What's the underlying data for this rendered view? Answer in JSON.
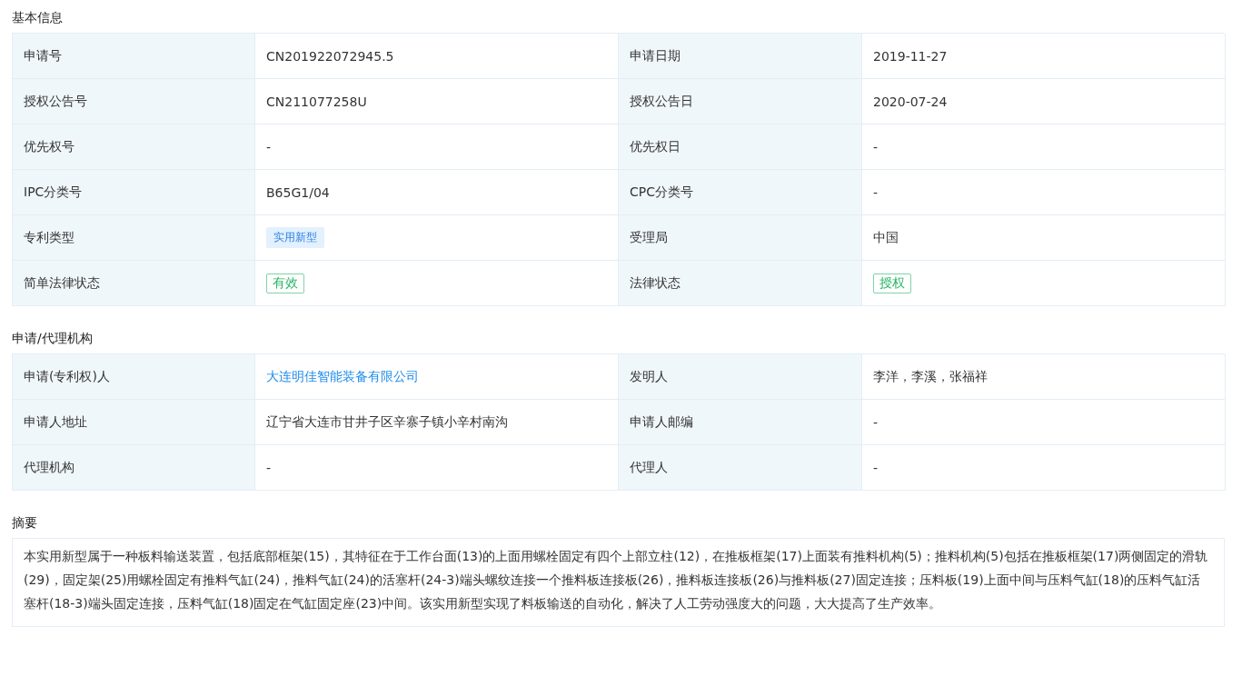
{
  "sections": [
    {
      "title": "基本信息",
      "rows": [
        [
          {
            "label": "申请号",
            "value": "CN201922072945.5",
            "kind": "text"
          },
          {
            "label": "申请日期",
            "value": "2019-11-27",
            "kind": "text"
          }
        ],
        [
          {
            "label": "授权公告号",
            "value": "CN211077258U",
            "kind": "text"
          },
          {
            "label": "授权公告日",
            "value": "2020-07-24",
            "kind": "text"
          }
        ],
        [
          {
            "label": "优先权号",
            "value": "-",
            "kind": "text"
          },
          {
            "label": "优先权日",
            "value": "-",
            "kind": "text"
          }
        ],
        [
          {
            "label": "IPC分类号",
            "value": "B65G1/04",
            "kind": "text"
          },
          {
            "label": "CPC分类号",
            "value": "-",
            "kind": "text"
          }
        ],
        [
          {
            "label": "专利类型",
            "value": "实用新型",
            "kind": "tag"
          },
          {
            "label": "受理局",
            "value": "中国",
            "kind": "text"
          }
        ],
        [
          {
            "label": "简单法律状态",
            "value": "有效",
            "kind": "status"
          },
          {
            "label": "法律状态",
            "value": "授权",
            "kind": "status"
          }
        ]
      ]
    },
    {
      "title": "申请/代理机构",
      "rows": [
        [
          {
            "label": "申请(专利权)人",
            "value": "大连明佳智能装备有限公司",
            "kind": "link"
          },
          {
            "label": "发明人",
            "value": "李洋，李溪，张福祥",
            "kind": "text"
          }
        ],
        [
          {
            "label": "申请人地址",
            "value": "辽宁省大连市甘井子区辛寨子镇小辛村南沟",
            "kind": "text"
          },
          {
            "label": "申请人邮编",
            "value": "-",
            "kind": "text"
          }
        ],
        [
          {
            "label": "代理机构",
            "value": "-",
            "kind": "text"
          },
          {
            "label": "代理人",
            "value": "-",
            "kind": "text"
          }
        ]
      ]
    }
  ],
  "abstract": {
    "title": "摘要",
    "text": "本实用新型属于一种板料输送装置，包括底部框架(15)，其特征在于工作台面(13)的上面用螺栓固定有四个上部立柱(12)，在推板框架(17)上面装有推料机构(5)；推料机构(5)包括在推板框架(17)两侧固定的滑轨(29)，固定架(25)用螺栓固定有推料气缸(24)，推料气缸(24)的活塞杆(24-3)端头螺纹连接一个推料板连接板(26)，推料板连接板(26)与推料板(27)固定连接；压料板(19)上面中间与压料气缸(18)的压料气缸活塞杆(18-3)端头固定连接，压料气缸(18)固定在气缸固定座(23)中间。该实用新型实现了料板输送的自动化，解决了人工劳动强度大的问题，大大提高了生产效率。"
  }
}
